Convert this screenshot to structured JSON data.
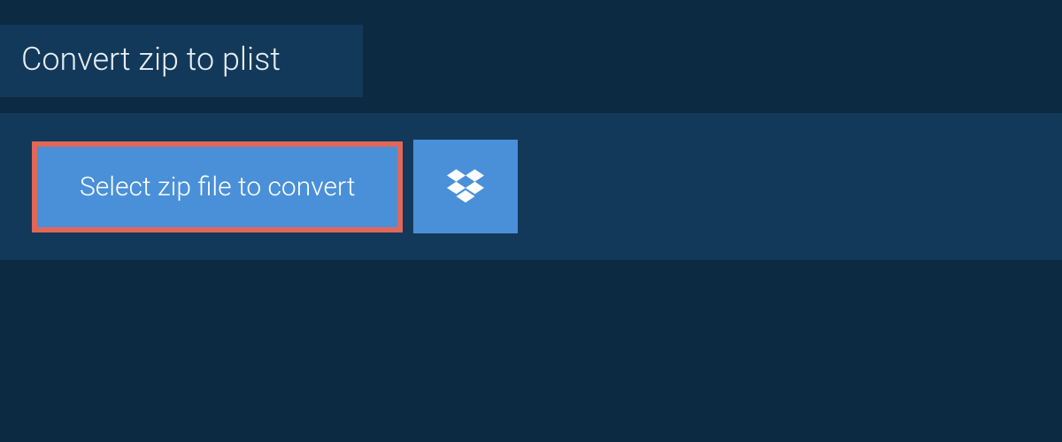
{
  "header": {
    "title": "Convert zip to plist"
  },
  "main": {
    "select_button_label": "Select zip file to convert"
  },
  "colors": {
    "background_dark": "#0c2a42",
    "panel": "#13395a",
    "button_primary": "#4a90d9",
    "highlight_border": "#e1675a",
    "text_light": "#e8eef3"
  }
}
